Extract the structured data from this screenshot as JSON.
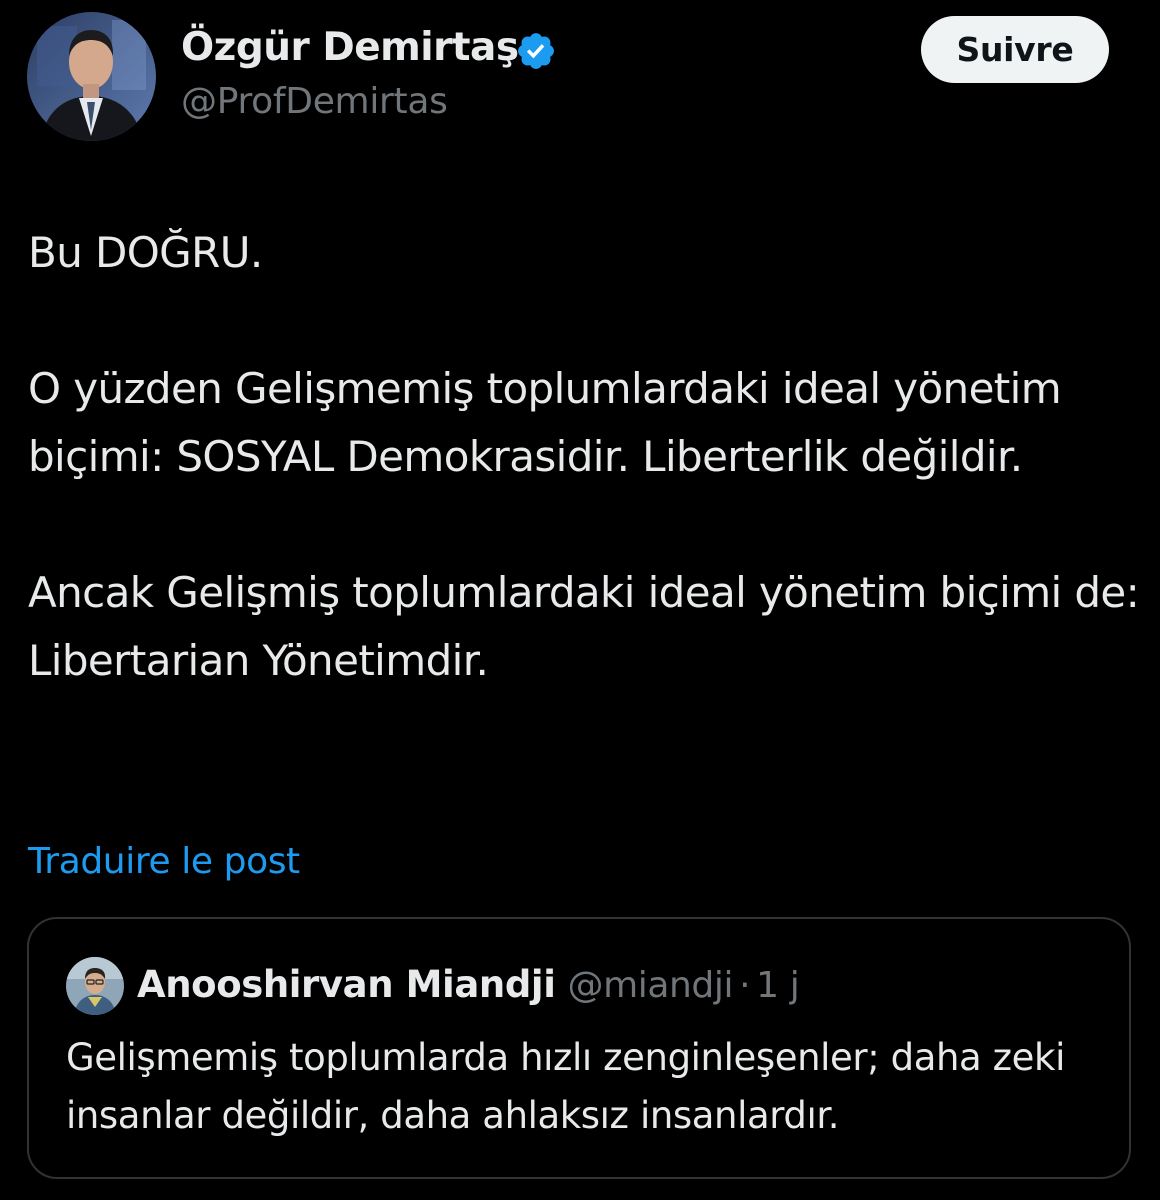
{
  "author": {
    "display_name": "Özgür Demirtaş",
    "handle": "@ProfDemirtas",
    "verified_icon": "verified-badge-icon",
    "avatar_icon": "profile-photo"
  },
  "follow_button": {
    "label": "Suivre"
  },
  "tweet": {
    "paragraphs": [
      "Bu DOĞRU.",
      "O yüzden Gelişmemiş toplumlardaki ideal yönetim biçimi: SOSYAL Demokrasidir. Liberterlik değildir.",
      "Ancak Gelişmiş toplumlardaki ideal yönetim biçimi de: Libertarian Yönetimdir."
    ]
  },
  "translate": {
    "label": "Traduire le post"
  },
  "quote": {
    "display_name": "Anooshirvan Miandji",
    "handle": "@miandji",
    "separator": "·",
    "time": "1 j",
    "text": "Gelişmemiş toplumlarda hızlı zenginleşenler; daha zeki insanlar değildir, daha ahlaksız insanlardır."
  },
  "colors": {
    "background": "#000000",
    "text_primary": "#e7e9ea",
    "text_secondary": "#71767b",
    "link": "#1d9bf0",
    "verified": "#1d9bf0",
    "border": "#2f3336",
    "button_bg": "#eff3f4"
  }
}
